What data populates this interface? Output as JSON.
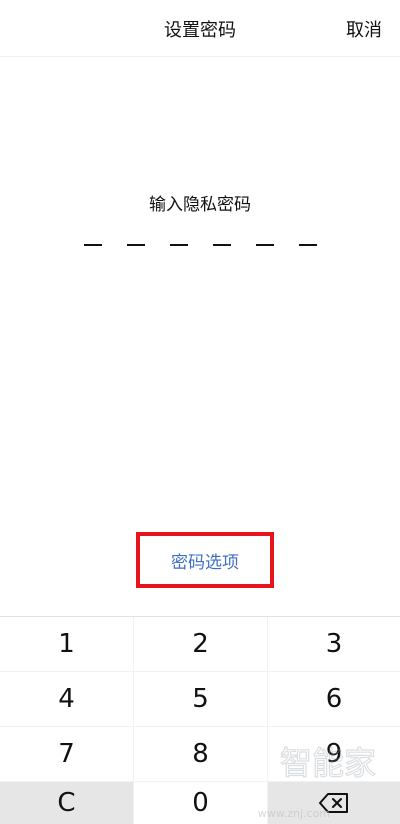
{
  "header": {
    "title": "设置密码",
    "cancel_label": "取消"
  },
  "prompt": "输入隐私密码",
  "pin_length": 6,
  "options_link": "密码选项",
  "keypad": {
    "row1": [
      "1",
      "2",
      "3"
    ],
    "row2": [
      "4",
      "5",
      "6"
    ],
    "row3": [
      "7",
      "8",
      "9"
    ],
    "clear_label": "C",
    "zero_label": "0",
    "backspace_icon": "backspace-icon"
  },
  "watermark": {
    "text": "智能家",
    "url": "www.znj.com"
  },
  "colors": {
    "link": "#3f6fc4",
    "highlight_box": "#e8141b",
    "keypad_bg": "#f2f2f2",
    "key_gray": "#e6e6e6"
  }
}
